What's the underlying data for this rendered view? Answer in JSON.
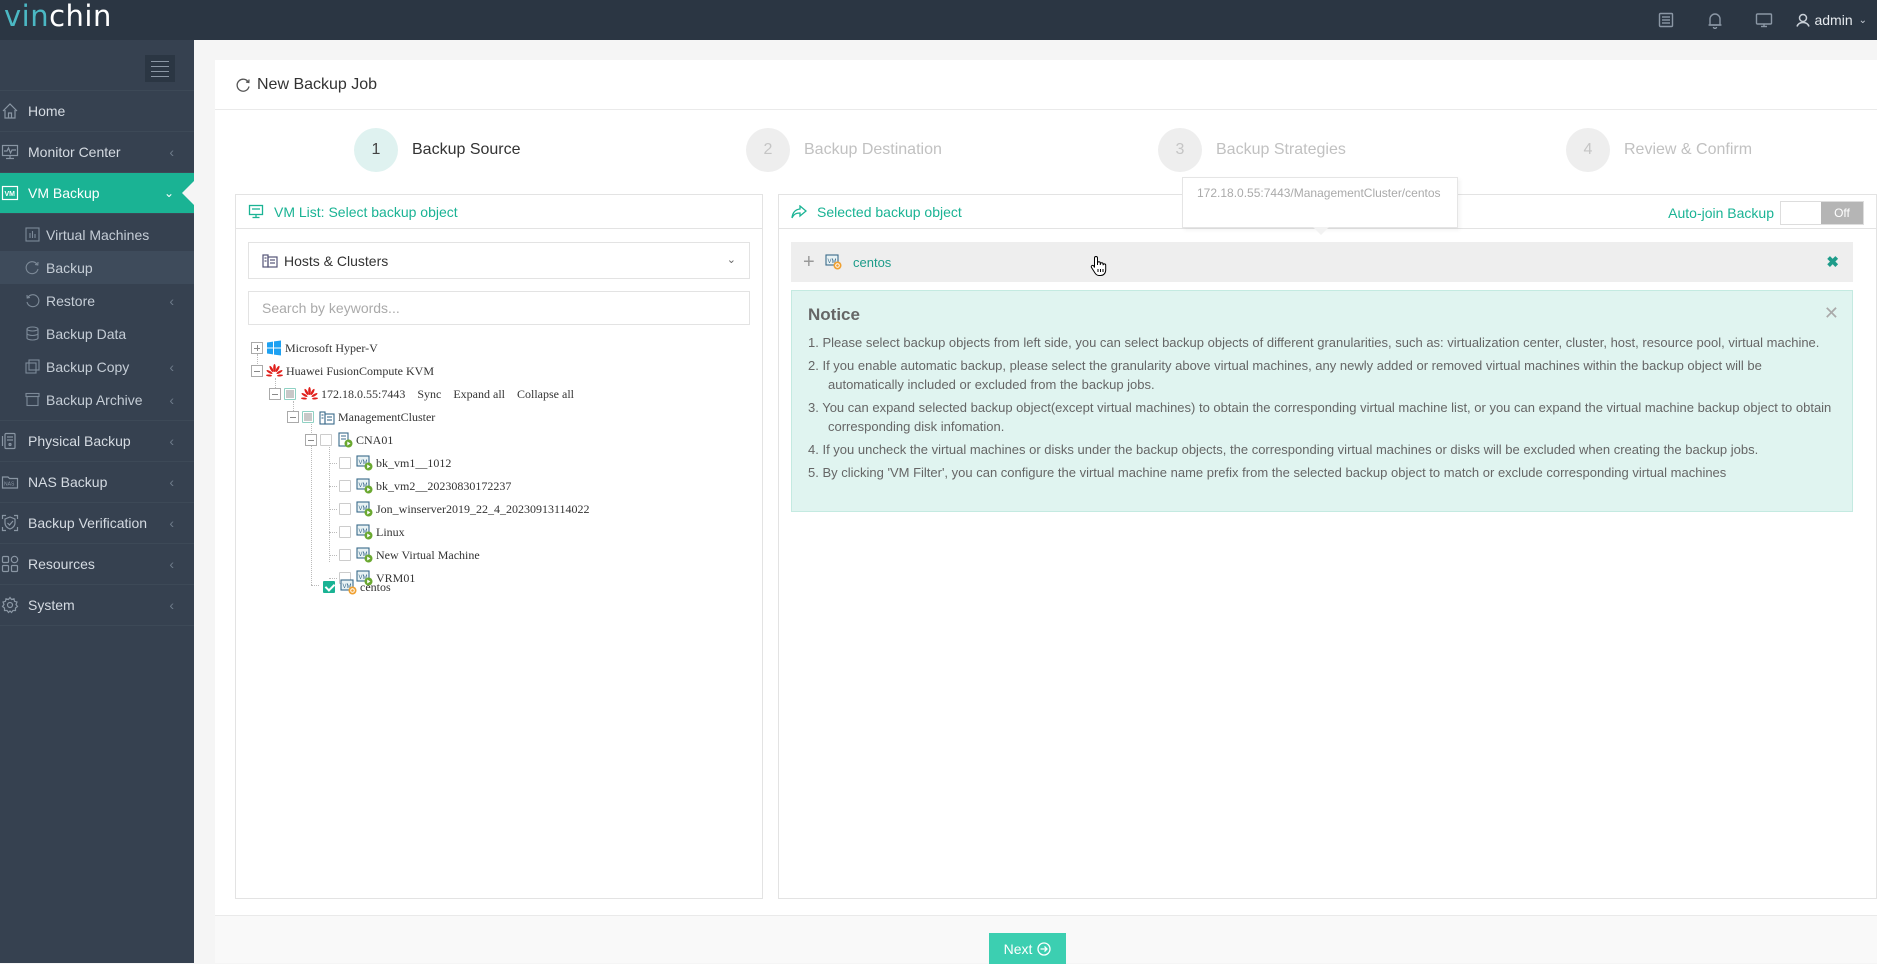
{
  "app": {
    "logo_part1": "vin",
    "logo_part2": "chin",
    "user": "admin"
  },
  "topbar": {
    "icons": [
      "list-icon",
      "bell-icon",
      "monitor-icon",
      "user-icon"
    ]
  },
  "sidebar": {
    "items": [
      {
        "label": "Home",
        "icon": "home-icon",
        "has_arrow": false
      },
      {
        "label": "Monitor Center",
        "icon": "monitor-icon",
        "has_arrow": true
      },
      {
        "label": "VM Backup",
        "icon": "vm-icon",
        "has_arrow": true,
        "active": true
      },
      {
        "label": "Physical Backup",
        "icon": "server-icon",
        "has_arrow": true
      },
      {
        "label": "NAS Backup",
        "icon": "nas-icon",
        "has_arrow": true
      },
      {
        "label": "Backup Verification",
        "icon": "shield-check-icon",
        "has_arrow": true
      },
      {
        "label": "Resources",
        "icon": "grid-icon",
        "has_arrow": true
      },
      {
        "label": "System",
        "icon": "gear-icon",
        "has_arrow": true
      }
    ],
    "vm_backup_sub": [
      {
        "label": "Virtual Machines",
        "icon": "chart-icon",
        "has_arrow": false
      },
      {
        "label": "Backup",
        "icon": "refresh-icon",
        "has_arrow": false,
        "current": true
      },
      {
        "label": "Restore",
        "icon": "undo-icon",
        "has_arrow": true
      },
      {
        "label": "Backup Data",
        "icon": "database-icon",
        "has_arrow": false
      },
      {
        "label": "Backup Copy",
        "icon": "copy-icon",
        "has_arrow": true
      },
      {
        "label": "Backup Archive",
        "icon": "archive-icon",
        "has_arrow": true
      }
    ]
  },
  "page": {
    "title": "New Backup Job"
  },
  "steps": [
    {
      "num": "1",
      "label": "Backup Source",
      "state": "active"
    },
    {
      "num": "2",
      "label": "Backup Destination",
      "state": "pending"
    },
    {
      "num": "3",
      "label": "Backup Strategies",
      "state": "pending"
    },
    {
      "num": "4",
      "label": "Review & Confirm",
      "state": "pending"
    }
  ],
  "left_panel": {
    "title": "VM List: Select backup object",
    "view_select": "Hosts & Clusters",
    "search_placeholder": "Search by keywords...",
    "tree": {
      "hyperv": "Microsoft Hyper-V",
      "huawei": "Huawei FusionCompute KVM",
      "host": "172.18.0.55:7443",
      "actions": {
        "sync": "Sync",
        "expand": "Expand all",
        "collapse": "Collapse all"
      },
      "cluster": "ManagementCluster",
      "cna": "CNA01",
      "vms": [
        {
          "name": "bk_vm1__1012",
          "checked": false
        },
        {
          "name": "bk_vm2__20230830172237",
          "checked": false
        },
        {
          "name": "Jon_winserver2019_22_4_20230913114022",
          "checked": false
        },
        {
          "name": "Linux",
          "checked": false
        },
        {
          "name": "New Virtual Machine",
          "checked": false
        },
        {
          "name": "VRM01",
          "checked": false
        }
      ],
      "centos": {
        "name": "centos",
        "checked": true
      }
    }
  },
  "right_panel": {
    "title": "Selected backup object",
    "autojoin_label": "Auto-join Backup",
    "autojoin_state": "Off",
    "selected": [
      {
        "name": "centos"
      }
    ],
    "tooltip": "172.18.0.55:7443/ManagementCluster/centos",
    "notice": {
      "title": "Notice",
      "items": [
        "1. Please select backup objects from left side, you can select backup objects of different granularities, such as: virtualization center, cluster, host, resource pool, virtual machine.",
        "2. If you enable automatic backup, please select the granularity above virtual machines, any newly added or removed virtual machines within the backup object will be automatically included or excluded from the backup jobs.",
        "3. You can expand selected backup object(except virtual machines) to obtain the corresponding virtual machine list, or you can expand the virtual machine backup object to obtain corresponding disk infomation.",
        "4. If you uncheck the virtual machines or disks under the backup objects, the corresponding virtual machines or disks will be excluded when creating the backup jobs.",
        "5. By clicking 'VM Filter', you can configure the virtual machine name prefix from the selected backup object to match or exclude corresponding virtual machines"
      ]
    }
  },
  "footer": {
    "next_label": "Next"
  },
  "colors": {
    "accent": "#1ab394",
    "sidebar_bg": "#364150",
    "topbar_bg": "#2b3643",
    "next_button": "#3ccfb1",
    "notice_bg": "#e0f4f0"
  }
}
